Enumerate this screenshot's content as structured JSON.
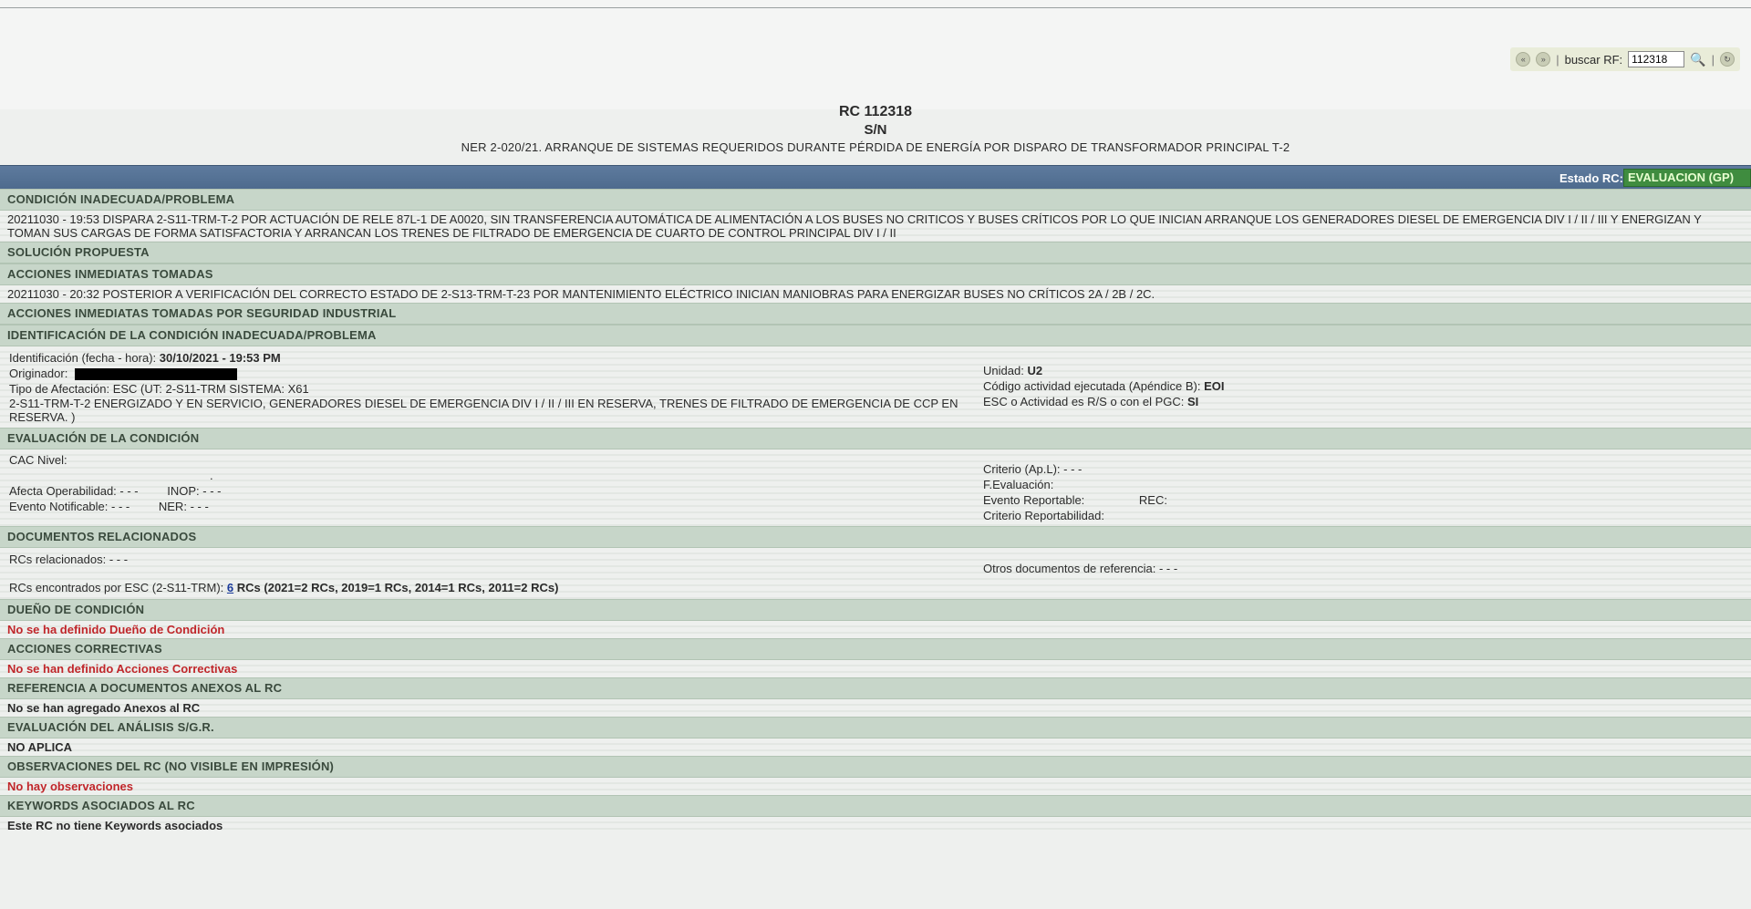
{
  "search": {
    "label": "buscar RF:",
    "value": "112318"
  },
  "header": {
    "rc": "RC 112318",
    "sn": "S/N",
    "title": "NER 2-020/21. ARRANQUE DE SISTEMAS REQUERIDOS DURANTE PÉRDIDA DE ENERGÍA POR DISPARO DE TRANSFORMADOR PRINCIPAL T-2"
  },
  "status": {
    "label": "Estado RC:",
    "value": "EVALUACION (GP)"
  },
  "sections": {
    "condicion": "CONDICIÓN INADECUADA/PROBLEMA",
    "condicion_text": "20211030 - 19:53 DISPARA 2-S11-TRM-T-2 POR ACTUACIÓN DE RELE 87L-1 DE A0020, SIN TRANSFERENCIA AUTOMÁTICA DE ALIMENTACIÓN A LOS BUSES NO CRITICOS Y BUSES CRÍTICOS POR LO QUE INICIAN ARRANQUE LOS GENERADORES DIESEL DE EMERGENCIA DIV I / II / III Y ENERGIZAN Y TOMAN SUS CARGAS DE FORMA SATISFACTORIA Y ARRANCAN LOS TRENES DE FILTRADO DE EMERGENCIA DE CUARTO DE CONTROL PRINCIPAL DIV I / II",
    "solucion": "SOLUCIÓN PROPUESTA",
    "acciones_inmediatas": "ACCIONES INMEDIATAS TOMADAS",
    "acciones_inmediatas_text": "20211030 - 20:32 POSTERIOR A VERIFICACIÓN DEL CORRECTO ESTADO DE 2-S13-TRM-T-23 POR MANTENIMIENTO ELÉCTRICO INICIAN MANIOBRAS PARA ENERGIZAR BUSES NO CRÍTICOS 2A / 2B / 2C.",
    "acciones_seguridad": "ACCIONES INMEDIATAS TOMADAS POR SEGURIDAD INDUSTRIAL",
    "identificacion": "IDENTIFICACIÓN DE LA CONDICIÓN INADECUADA/PROBLEMA",
    "evaluacion": "EVALUACIÓN DE LA CONDICIÓN",
    "documentos": "DOCUMENTOS RELACIONADOS",
    "dueno": "DUEÑO DE CONDICIÓN",
    "dueno_text": "No se ha definido Dueño de Condición",
    "correctivas": "ACCIONES CORRECTIVAS",
    "correctivas_text": "No se han definido Acciones Correctivas",
    "anexos": "REFERENCIA A DOCUMENTOS ANEXOS AL RC",
    "anexos_text": "No se han agregado Anexos al RC",
    "sgr": "EVALUACIÓN DEL ANÁLISIS S/G.R.",
    "sgr_text": "NO APLICA",
    "observaciones": "OBSERVACIONES DEL RC (NO VISIBLE EN IMPRESIÓN)",
    "observaciones_text": "No hay observaciones",
    "keywords": "KEYWORDS ASOCIADOS AL RC",
    "keywords_text": "Este RC no tiene Keywords asociados"
  },
  "identificacion": {
    "fecha_label": "Identificación (fecha - hora):",
    "fecha_value": "30/10/2021 - 19:53 PM",
    "originador_label": "Originador:",
    "tipo_label": "Tipo de Afectación: ESC (UT: 2-S11-TRM   SISTEMA: X61",
    "tipo_text": "2-S11-TRM-T-2 ENERGIZADO Y EN SERVICIO, GENERADORES DIESEL DE EMERGENCIA DIV I / II / III EN RESERVA, TRENES DE FILTRADO DE EMERGENCIA DE CCP EN RESERVA. )",
    "unidad_label": "Unidad:",
    "unidad_value": "U2",
    "codigo_label": "Código actividad ejecutada (Apéndice B):",
    "codigo_value": "EOI",
    "esc_label": "ESC o Actividad es R/S o con el PGC:",
    "esc_value": "SI"
  },
  "evaluacion": {
    "cac_label": "CAC Nivel:",
    "cac_value": ".",
    "opera_label": "Afecta Operabilidad:",
    "opera_value": "- - -",
    "inop_label": "INOP:",
    "inop_value": "- - -",
    "notif_label": "Evento Notificable:",
    "notif_value": "- - -",
    "ner_label": "NER:",
    "ner_value": "- - -",
    "criterio_label": "Criterio (Ap.L):",
    "criterio_value": "- - -",
    "feval_label": "F.Evaluación:",
    "reportable_label": "Evento Reportable:",
    "rec_label": "REC:",
    "crit_rep_label": "Criterio Reportabilidad:"
  },
  "documentos": {
    "rcs_label": "RCs relacionados:",
    "rcs_value": "- - -",
    "otros_label": "Otros documentos de referencia:",
    "otros_value": "- - -",
    "encontrados_label": "RCs encontrados por ESC (2-S11-TRM):",
    "encontrados_link": "6",
    "encontrados_text": "RCs (2021=2 RCs, 2019=1 RCs, 2014=1 RCs, 2011=2 RCs)"
  }
}
